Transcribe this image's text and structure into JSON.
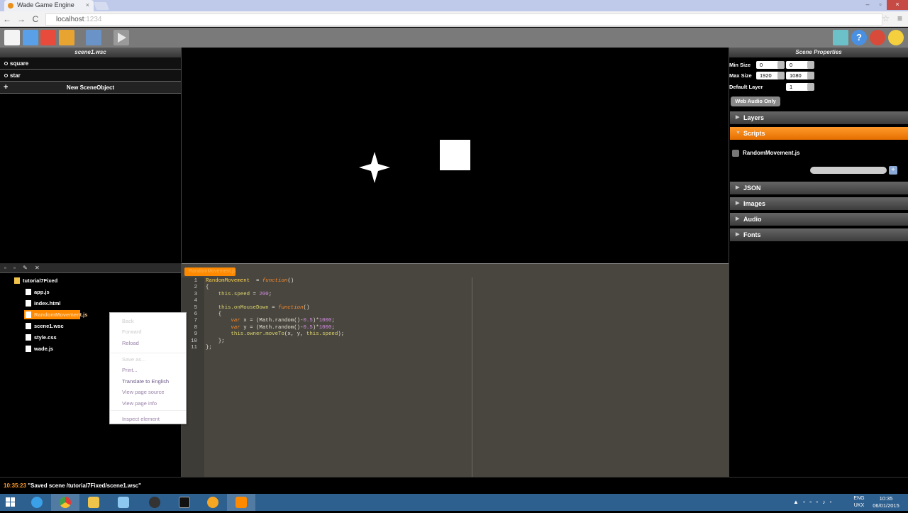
{
  "browser": {
    "tab_title": "Wade Game Engine",
    "tab_close": "×",
    "url_host": "localhost",
    "url_port": ":1234",
    "back": "←",
    "forward": "→",
    "reload": "C",
    "star": "☆",
    "menu": "≡",
    "window_controls": [
      "–",
      "▫",
      "×"
    ]
  },
  "scene_panel": {
    "title": "scene1.wsc",
    "objects": [
      "square",
      "star"
    ],
    "new_object_label": "New SceneObject",
    "plus": "+"
  },
  "scene_properties": {
    "title": "Scene Properties",
    "min_size_label": "Min Size",
    "min_size": [
      "0",
      "0"
    ],
    "max_size_label": "Max Size",
    "max_size": [
      "1920",
      "1080"
    ],
    "default_layer_label": "Default Layer",
    "default_layer": "1",
    "web_audio_button": "Web Audio Only",
    "sections": [
      "Layers",
      "Scripts",
      "JSON",
      "Images",
      "Audio",
      "Fonts"
    ],
    "active_section": "Scripts",
    "script_file": "RandomMovement.js",
    "script_add": "+"
  },
  "file_tree": {
    "tools": "▫ ▫ ✎ ✕",
    "root": "tutorial7Fixed",
    "files": [
      "app.js",
      "index.html",
      "RandomMovement.js",
      "scene1.wsc",
      "style.css",
      "wade.js"
    ],
    "selected": "RandomMovement.js"
  },
  "code_editor": {
    "tab": "RandomMovement.js",
    "lines": [
      {
        "n": "1",
        "parts": [
          [
            "fn",
            "RandomMovement"
          ],
          [
            "",
            "  = "
          ],
          [
            "kw",
            "function"
          ],
          [
            "",
            "()"
          ]
        ]
      },
      {
        "n": "2",
        "parts": [
          [
            "",
            "{"
          ]
        ]
      },
      {
        "n": "3",
        "parts": [
          [
            "",
            "    "
          ],
          [
            "pr",
            "this.speed"
          ],
          [
            "",
            " = "
          ],
          [
            "nm",
            "200"
          ],
          [
            "",
            ";"
          ]
        ]
      },
      {
        "n": "4",
        "parts": [
          [
            "",
            ""
          ]
        ]
      },
      {
        "n": "5",
        "parts": [
          [
            "",
            "    "
          ],
          [
            "pr",
            "this.onMouseDown"
          ],
          [
            "",
            " = "
          ],
          [
            "kw",
            "function"
          ],
          [
            "",
            "()"
          ]
        ]
      },
      {
        "n": "6",
        "parts": [
          [
            "",
            "    {"
          ]
        ]
      },
      {
        "n": "7",
        "parts": [
          [
            "",
            "        "
          ],
          [
            "kw",
            "var"
          ],
          [
            "",
            " x = (Math.random()-"
          ],
          [
            "nm",
            "0.5"
          ],
          [
            "",
            ")*"
          ],
          [
            "nm",
            "1000"
          ],
          [
            "",
            ";"
          ]
        ]
      },
      {
        "n": "8",
        "parts": [
          [
            "",
            "        "
          ],
          [
            "kw",
            "var"
          ],
          [
            "",
            " y = (Math.random()-"
          ],
          [
            "nm",
            "0.5"
          ],
          [
            "",
            ")*"
          ],
          [
            "nm",
            "1000"
          ],
          [
            "",
            ";"
          ]
        ]
      },
      {
        "n": "9",
        "parts": [
          [
            "",
            "        "
          ],
          [
            "pr",
            "this.owner.moveTo"
          ],
          [
            "",
            "(x, y, "
          ],
          [
            "pr",
            "this.speed"
          ],
          [
            "",
            ");"
          ]
        ]
      },
      {
        "n": "10",
        "parts": [
          [
            "",
            "    };"
          ]
        ]
      },
      {
        "n": "11",
        "parts": [
          [
            "",
            "};"
          ]
        ]
      }
    ]
  },
  "context_menu": {
    "items": [
      {
        "label": "Back",
        "state": "dis"
      },
      {
        "label": "Forward",
        "state": "dis"
      },
      {
        "label": "Reload",
        "state": ""
      },
      {
        "label": "Save as...",
        "state": "dis"
      },
      {
        "label": "Print...",
        "state": ""
      },
      {
        "label": "Translate to English",
        "state": "strong"
      },
      {
        "label": "View page source",
        "state": ""
      },
      {
        "label": "View page info",
        "state": ""
      },
      {
        "label": "Inspect element",
        "state": ""
      }
    ]
  },
  "status": {
    "time": "10:35:23",
    "message": " \"Saved scene /tutorial7Fixed/scene1.wsc\""
  },
  "taskbar": {
    "lang_line1": "ENG",
    "lang_line2": "UKX",
    "clock_time": "10:35",
    "clock_date": "06/01/2015",
    "tray_icons": "▲ ▫ ▫ ▫ ♪ ▫"
  },
  "colors": {
    "accent": "#ff8a00",
    "taskbar": "#2d5f8f",
    "editor_bg": "#48463f"
  }
}
